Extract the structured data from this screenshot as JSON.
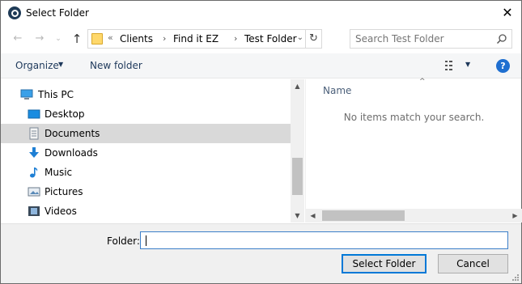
{
  "window": {
    "title": "Select Folder",
    "close_glyph": "✕",
    "icon": "app-search-icon"
  },
  "nav": {
    "back_glyph": "←",
    "forward_glyph": "→",
    "recent_glyph": "⌄",
    "up_glyph": "↑",
    "address_overflow": "«",
    "breadcrumbs": [
      "Clients",
      "Find it EZ",
      "Test Folder"
    ],
    "crumb_separator": "›",
    "dropdown_glyph": "⌄",
    "refresh_glyph": "↻",
    "search_placeholder": "Search Test Folder"
  },
  "toolbar": {
    "organize_label": "Organize",
    "organize_caret": "▼",
    "new_folder_label": "New folder",
    "view_caret": "▼",
    "help_label": "?"
  },
  "tree": {
    "items": [
      {
        "label": "This PC",
        "icon": "computer-icon"
      },
      {
        "label": "Desktop",
        "icon": "desktop-icon"
      },
      {
        "label": "Documents",
        "icon": "documents-icon",
        "selected": true
      },
      {
        "label": "Downloads",
        "icon": "downloads-icon"
      },
      {
        "label": "Music",
        "icon": "music-icon"
      },
      {
        "label": "Pictures",
        "icon": "pictures-icon"
      },
      {
        "label": "Videos",
        "icon": "videos-icon"
      }
    ]
  },
  "content": {
    "column_name": "Name",
    "sort_glyph": "^",
    "empty_message": "No items match your search."
  },
  "footer": {
    "folder_label": "Folder:",
    "folder_value": "",
    "select_button": "Select Folder",
    "cancel_button": "Cancel"
  },
  "colors": {
    "accent": "#0078d7",
    "selection": "#d9d9d9",
    "link": "#1e395b"
  }
}
